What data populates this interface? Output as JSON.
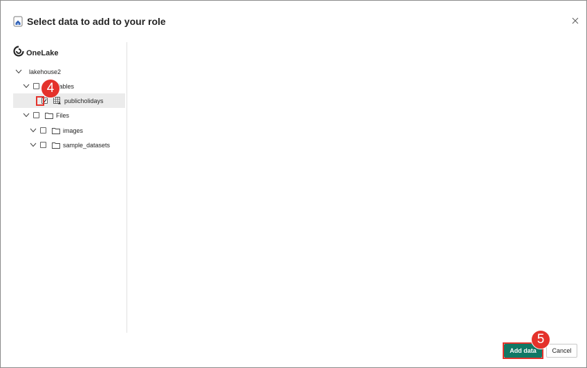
{
  "dialog": {
    "title": "Select data to add to your role",
    "title_icon": "lakehouse-icon",
    "close_icon": "close-icon"
  },
  "tree": {
    "root_label": "OneLake",
    "root_icon": "onelake-icon",
    "items": [
      {
        "label": "lakehouse2",
        "icon": "none",
        "checked": false,
        "expanded": true
      },
      {
        "label": "Tables",
        "icon": "folder-icon",
        "checked": false,
        "expanded": true
      },
      {
        "label": "publicholidays",
        "icon": "table-icon",
        "checked": true,
        "selected": true
      },
      {
        "label": "Files",
        "icon": "folder-icon",
        "checked": false,
        "expanded": true
      },
      {
        "label": "images",
        "icon": "folder-icon",
        "checked": false,
        "expanded": true
      },
      {
        "label": "sample_datasets",
        "icon": "folder-icon",
        "checked": false,
        "expanded": true
      }
    ]
  },
  "footer": {
    "add_label": "Add data",
    "cancel_label": "Cancel"
  },
  "annotations": {
    "step4": "4",
    "step5": "5"
  },
  "colors": {
    "primary": "#117865",
    "annotation": "#e4322b"
  }
}
